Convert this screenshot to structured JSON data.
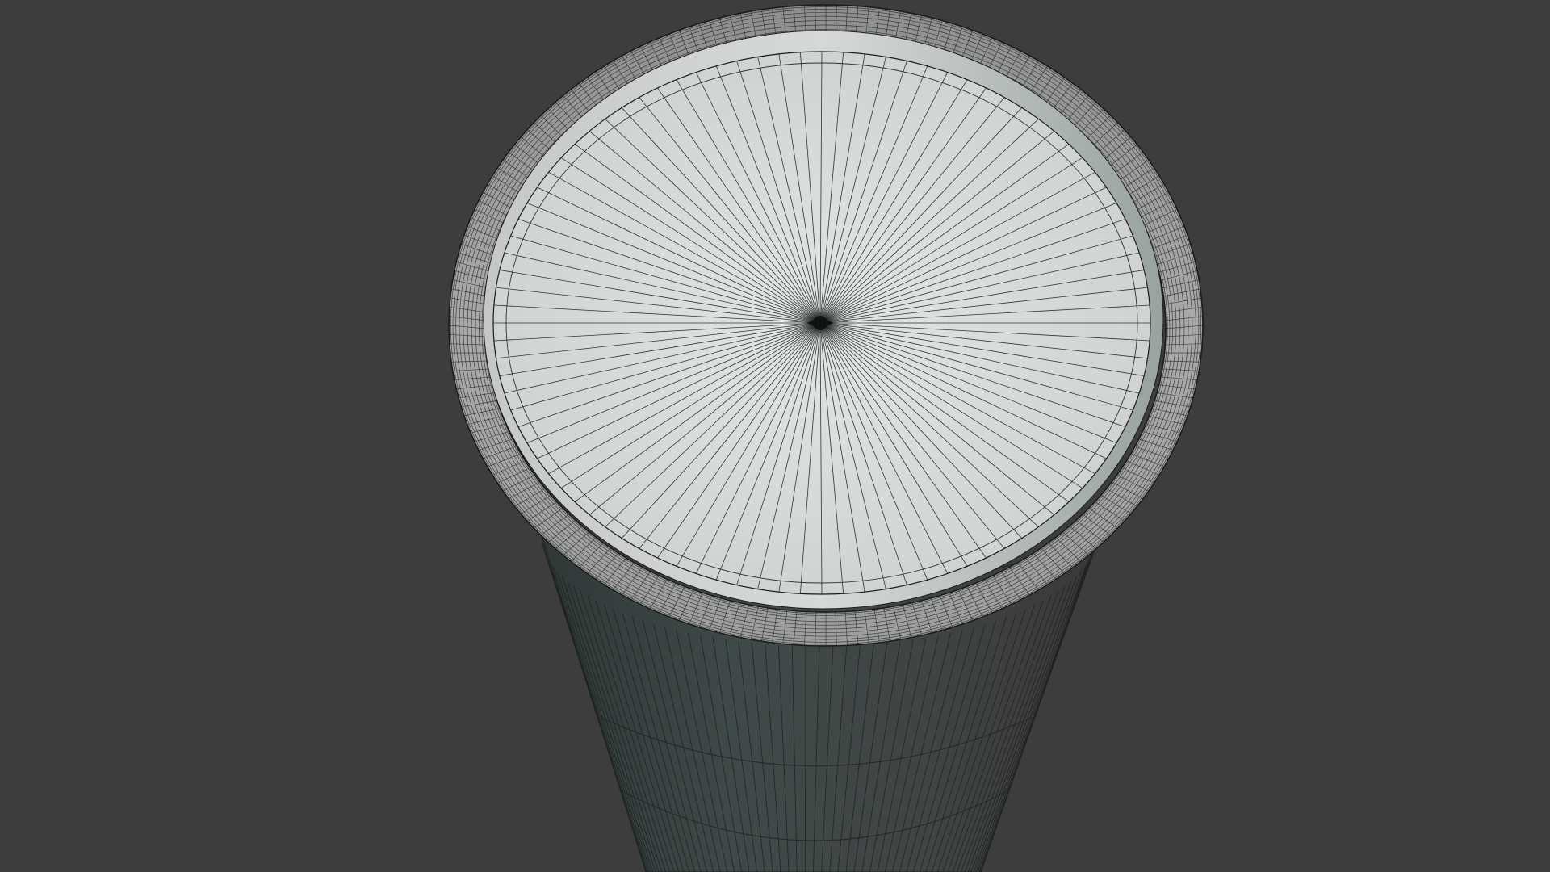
{
  "viewport": {
    "background": "#3d3d3d",
    "mode": "wireframe-overlay"
  },
  "object": {
    "type": "paper-cup",
    "body_color": "#4a5553",
    "rim_color": "#9a9a98",
    "lid_color": "#dcdede",
    "wire_color": "#1e2222",
    "lid_radial_segments": 96,
    "rim_loop_count": 14,
    "body_segments": 64
  }
}
